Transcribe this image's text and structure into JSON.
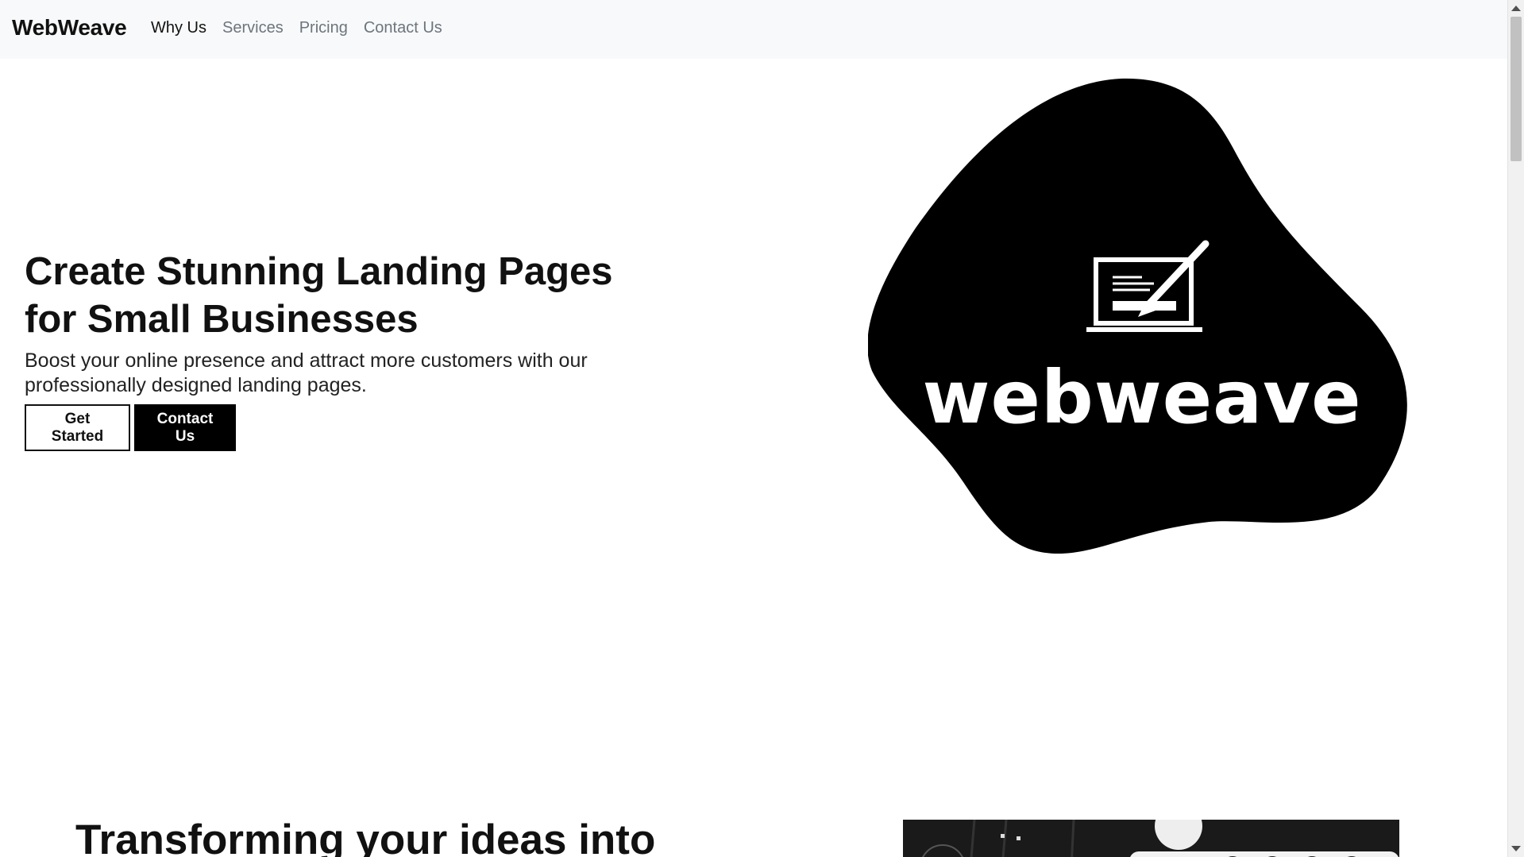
{
  "navbar": {
    "brand": "WebWeave",
    "links": [
      {
        "label": "Why Us",
        "active": true
      },
      {
        "label": "Services",
        "active": false
      },
      {
        "label": "Pricing",
        "active": false
      },
      {
        "label": "Contact Us",
        "active": false
      }
    ]
  },
  "hero": {
    "title_line1": "Create Stunning Landing Pages",
    "title_line2": "for Small Businesses",
    "subtitle": "Boost your online presence and attract more customers with our professionally designed landing pages.",
    "primary_button": "Get Started",
    "secondary_button": "Contact Us",
    "logo_wordmark": "webweave"
  },
  "section2": {
    "title": "Transforming your ideas into"
  },
  "colors": {
    "navbar_bg": "#f8f9fa",
    "accent": "#000000",
    "muted_link": "#6c757d"
  },
  "icons": {
    "logo_icon": "laptop-pen-icon"
  }
}
